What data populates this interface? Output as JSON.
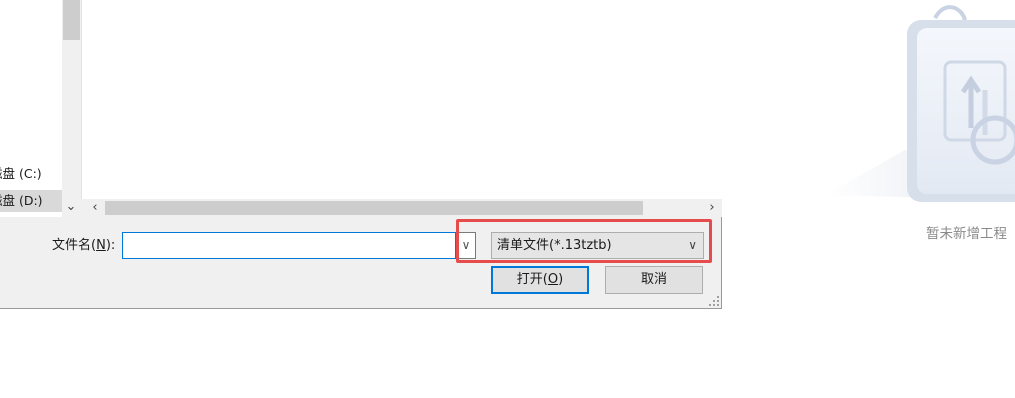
{
  "navigation": {
    "drives": [
      {
        "label": "磁盘 (C:)",
        "selected": false
      },
      {
        "label": "磁盘 (D:)",
        "selected": true
      }
    ]
  },
  "dialog": {
    "filename_label_text": "文件名(",
    "filename_label_key": "N",
    "filename_label_end": "):",
    "filename_value": "",
    "filetype_selected": "清单文件(*.13tztb)",
    "open_text": "打开(",
    "open_key": "O",
    "open_end": ")",
    "cancel_label": "取消",
    "highlight_color": "#e74c4c",
    "focus_color": "#0078d7"
  },
  "empty_state": {
    "text": "暂未新增工程",
    "icon": "folder-sync-icon"
  }
}
